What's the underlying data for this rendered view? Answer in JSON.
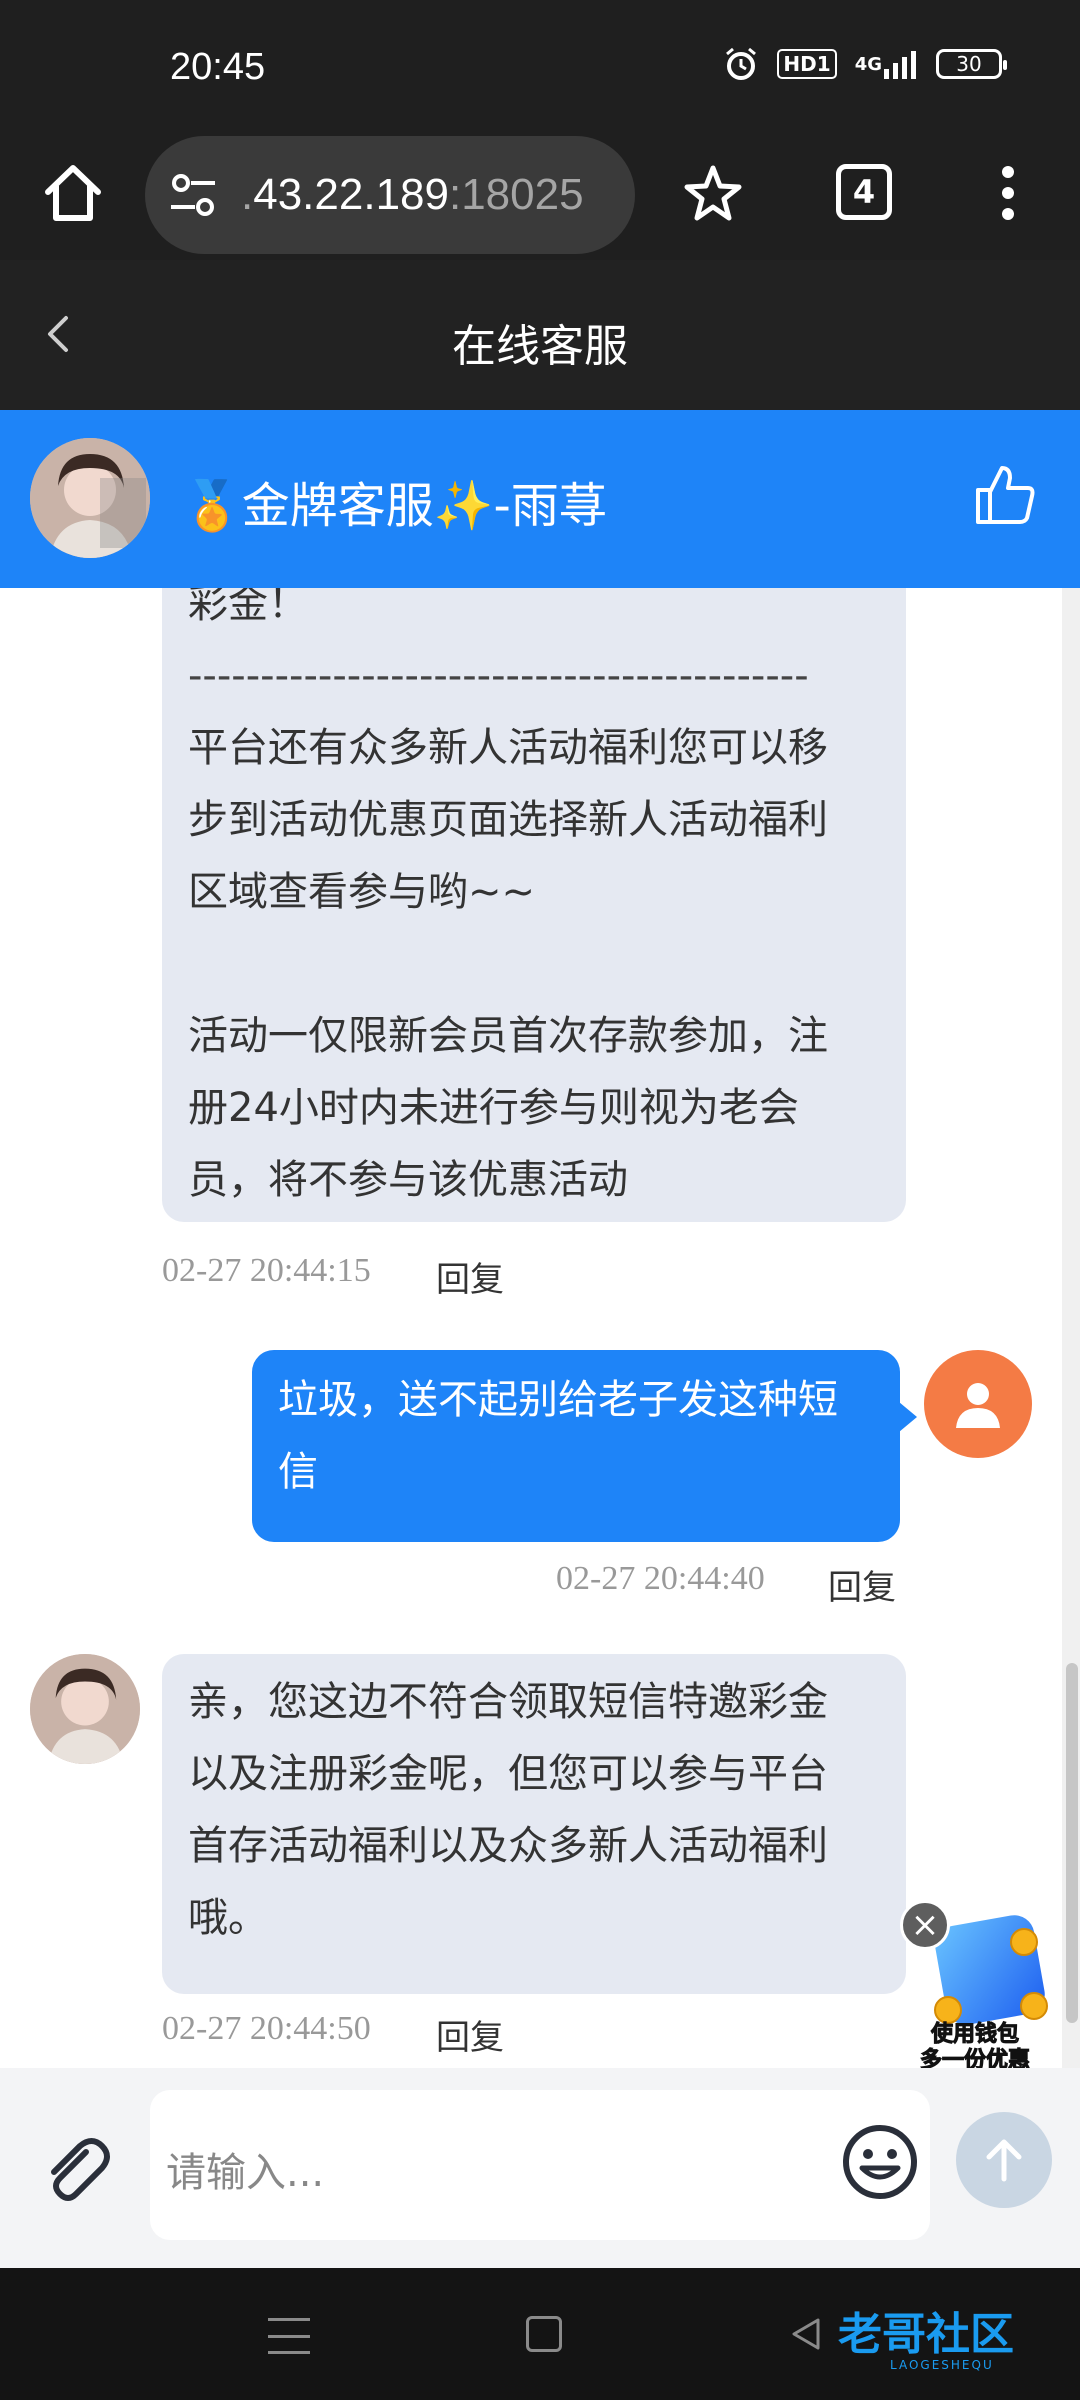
{
  "status_bar": {
    "time": "20:45",
    "hd_label": "HD1",
    "network_label": "4G",
    "battery": "30"
  },
  "browser": {
    "url_host_dim": ".",
    "url_host": "43.22.189",
    "url_port": ":18025",
    "tab_count": "4"
  },
  "page": {
    "title": "在线客服"
  },
  "agent": {
    "name": "🏅金牌客服✨-雨荨"
  },
  "messages": [
    {
      "side": "in",
      "lines": [
        "彩金！",
        "-------------------------------------------",
        "平台还有众多新人活动福利您可以移",
        "步到活动优惠页面选择新人活动福利",
        "区域查看参与哟~~",
        "",
        "活动一仅限新会员首次存款参加，注",
        "册24小时内未进行参与则视为老会",
        "员，将不参与该优惠活动"
      ],
      "time": "02-27 20:44:15",
      "reply": "回复"
    },
    {
      "side": "out",
      "lines": [
        "垃圾，送不起别给老子发这种短",
        "信"
      ],
      "time": "02-27 20:44:40",
      "reply": "回复"
    },
    {
      "side": "in",
      "lines": [
        "亲，您这边不符合领取短信特邀彩金",
        "以及注册彩金呢，但您可以参与平台",
        "首存活动福利以及众多新人活动福利",
        "哦。"
      ],
      "time": "02-27 20:44:50",
      "reply": "回复"
    }
  ],
  "promo": {
    "close": "×",
    "line1": "使用钱包",
    "line2": "多一份优惠"
  },
  "composer": {
    "placeholder": "请输入..."
  },
  "watermark": {
    "text": "老哥社区",
    "sub": "LAOGESHEQU"
  },
  "colors": {
    "accent": "#1e84f8",
    "in_bubble": "#e5e9f2",
    "user_avatar": "#f47b45"
  },
  "icons": [
    "home-icon",
    "tune-icon",
    "star-icon",
    "more-icon",
    "back-icon",
    "thumbs-up-icon",
    "user-icon",
    "paperclip-icon",
    "smile-icon",
    "arrow-up-icon"
  ]
}
